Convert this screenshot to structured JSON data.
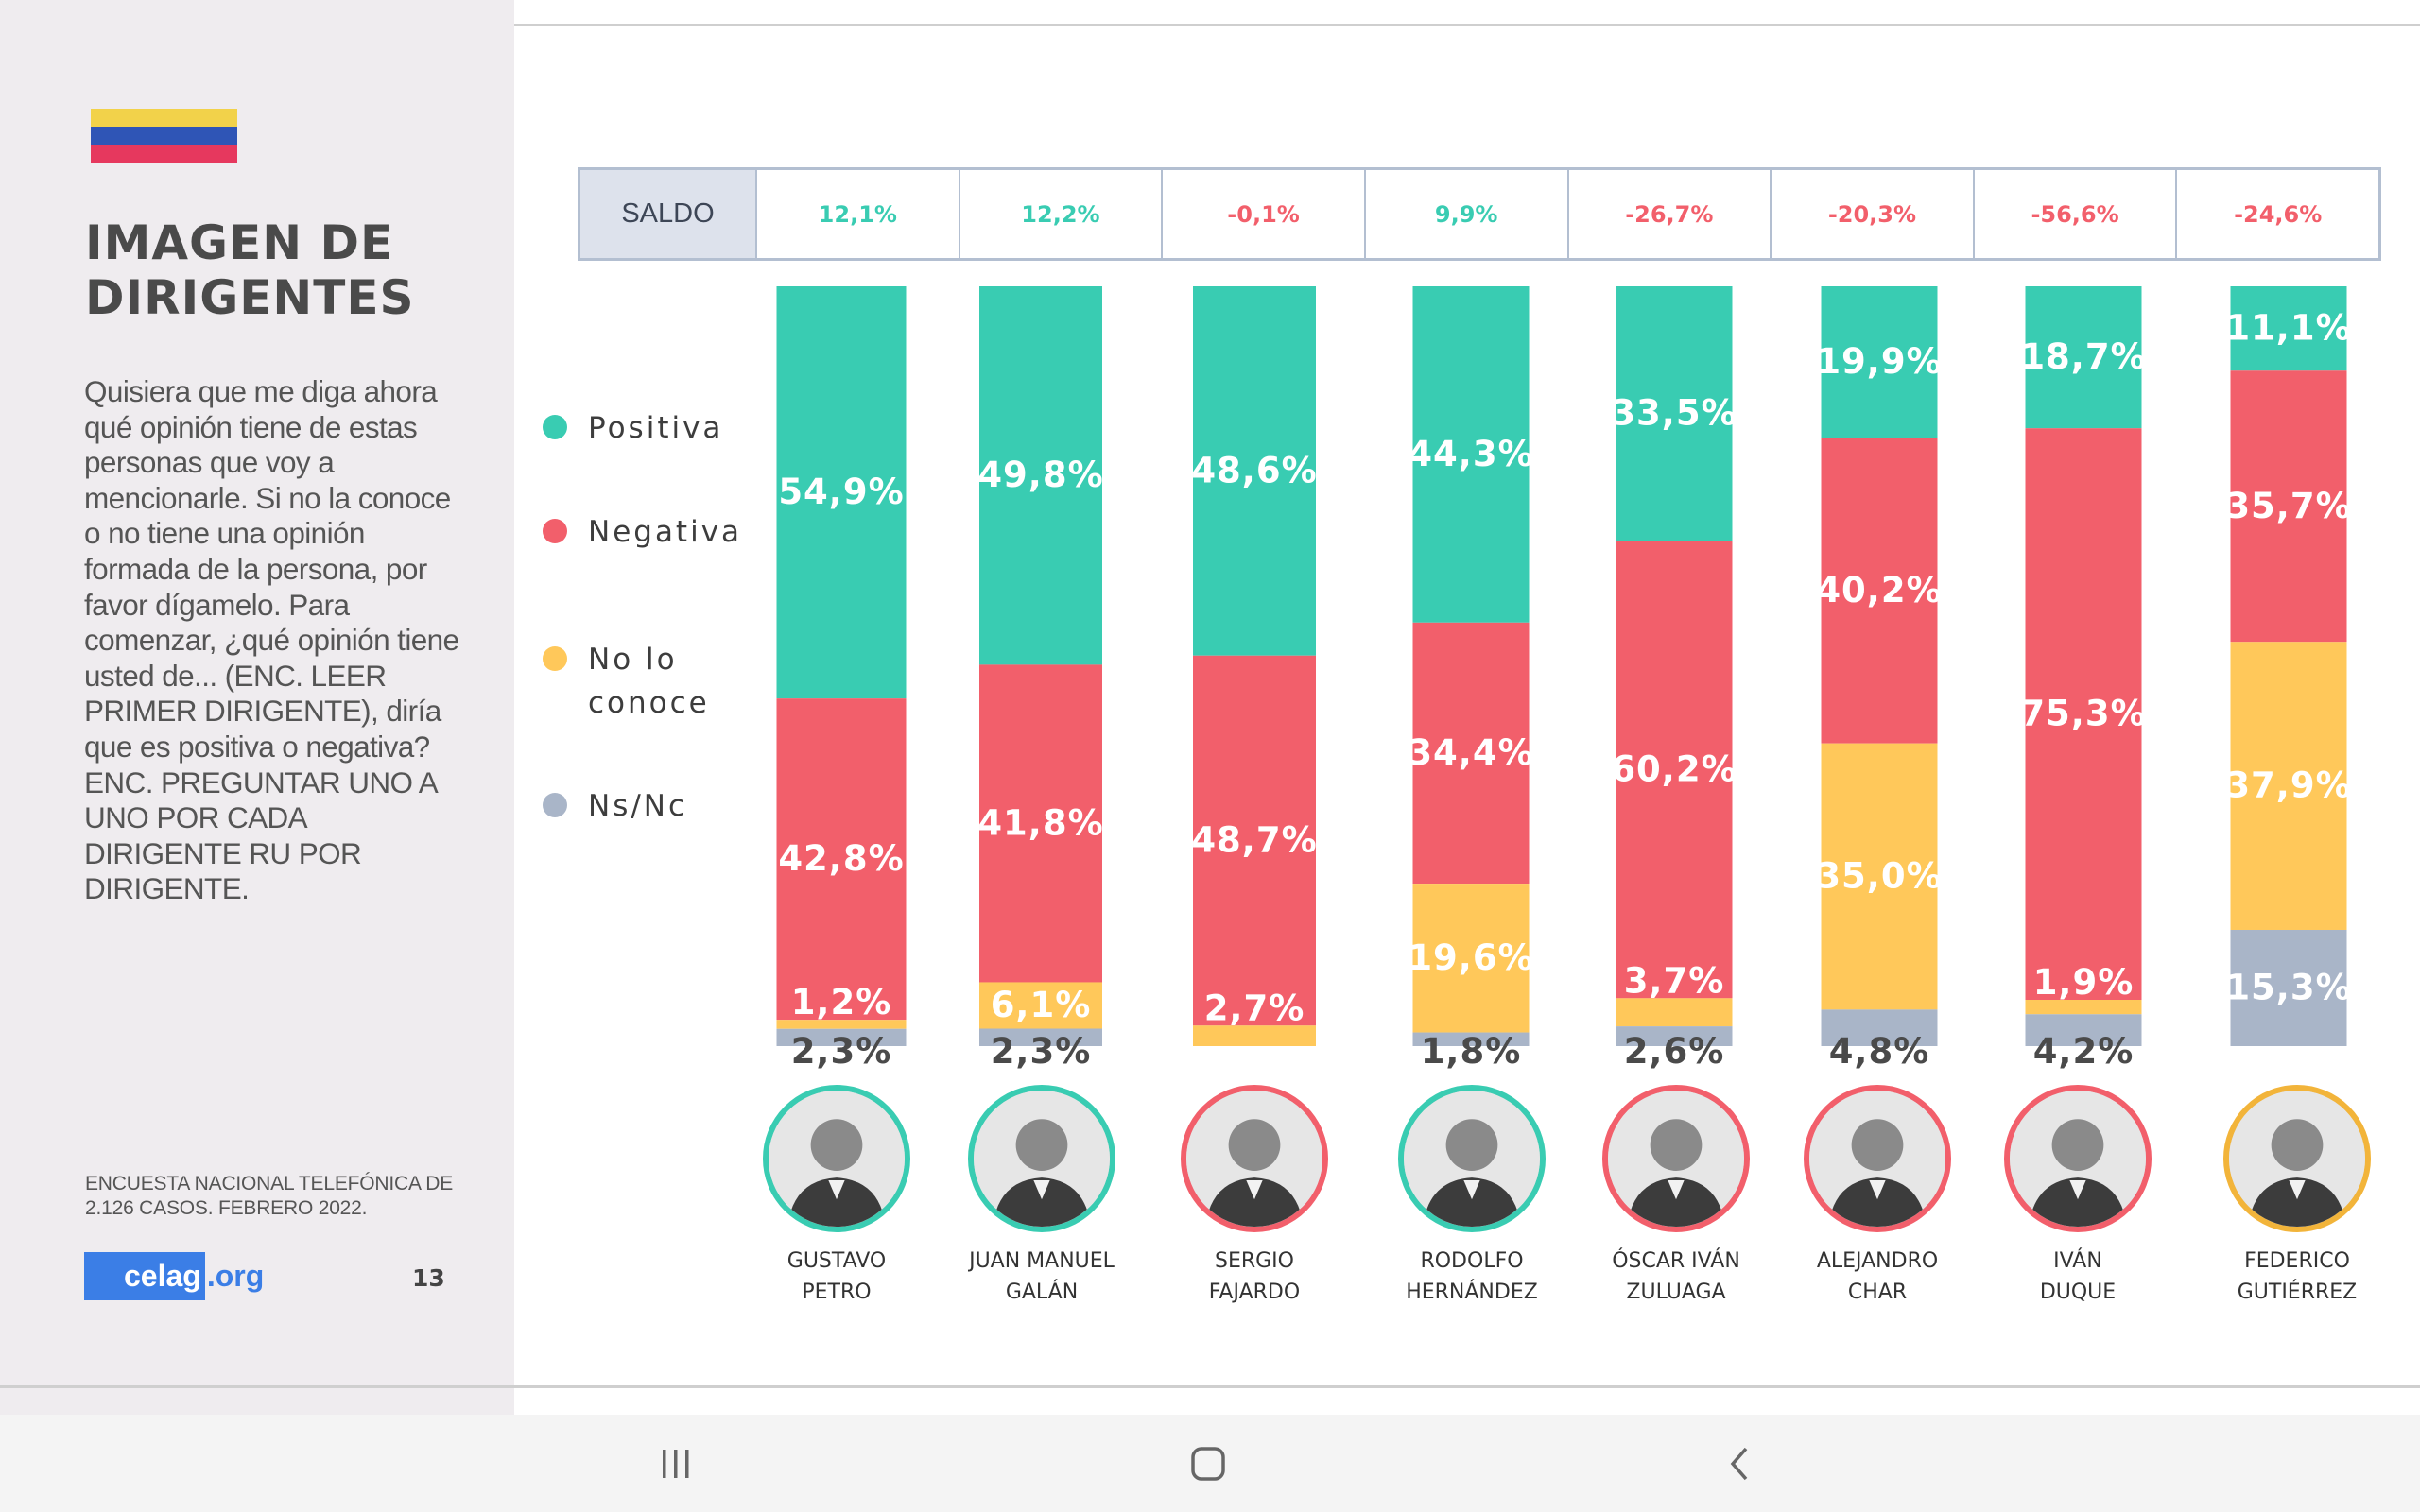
{
  "sidebar": {
    "title": "IMAGEN DE DIRIGENTES",
    "question": "Quisiera que me diga ahora qué opinión tiene de estas personas que voy a mencionarle. Si no la conoce o no tiene una opinión formada de la persona, por favor dígamelo. Para comenzar, ¿qué opinión tiene usted de... (ENC. LEER PRIMER DIRIGENTE), diría que es positiva o negativa? ENC. PREGUNTAR UNO A UNO POR CADA DIRIGENTE RU POR DIRIGENTE.",
    "source": "ENCUESTA NACIONAL TELEFÓNICA DE 2.126 CASOS. FEBRERO 2022.",
    "logo_main": "celag",
    "logo_ext": ".org",
    "page_number": "13"
  },
  "saldo": {
    "label": "SALDO",
    "values": [
      "12,1%",
      "12,2%",
      "-0,1%",
      "9,9%",
      "-26,7%",
      "-20,3%",
      "-56,6%",
      "-24,6%"
    ]
  },
  "legend": [
    {
      "label": "Positiva",
      "color": "#39ccb2"
    },
    {
      "label": "Negativa",
      "color": "#f25f6b"
    },
    {
      "label": "No lo conoce",
      "color": "#ffc85a"
    },
    {
      "label": "Ns/Nc",
      "color": "#a9b5c8"
    }
  ],
  "colors": {
    "positive": "#39ccb2",
    "negative": "#f25f6b",
    "unknown": "#ffc85a",
    "nsnc": "#a9b5c8",
    "saldo_positive": "#39ccb2",
    "saldo_negative": "#f25f6b"
  },
  "chart_data": {
    "type": "bar",
    "stacked": true,
    "categories": [
      "GUSTAVO PETRO",
      "JUAN MANUEL GALÁN",
      "SERGIO FAJARDO",
      "RODOLFO HERNÁNDEZ",
      "ÓSCAR IVÁN ZULUAGA",
      "ALEJANDRO CHAR",
      "IVÁN DUQUE",
      "FEDERICO GUTIÉRREZ"
    ],
    "series": [
      {
        "name": "Positiva",
        "values": [
          54.9,
          49.8,
          48.6,
          44.3,
          33.5,
          19.9,
          18.7,
          11.1
        ],
        "labels": [
          "54,9%",
          "49,8%",
          "48,6%",
          "44,3%",
          "33,5%",
          "19,9%",
          "18,7%",
          "11,1%"
        ]
      },
      {
        "name": "Negativa",
        "values": [
          42.8,
          41.8,
          48.7,
          34.4,
          60.2,
          40.2,
          75.3,
          35.7
        ],
        "labels": [
          "42,8%",
          "41,8%",
          "48,7%",
          "34,4%",
          "60,2%",
          "40,2%",
          "75,3%",
          "35,7%"
        ]
      },
      {
        "name": "No lo conoce",
        "values": [
          1.2,
          6.1,
          2.7,
          19.6,
          3.7,
          35.0,
          1.9,
          37.9
        ],
        "labels": [
          "1,2%",
          "6,1%",
          "2,7%",
          "19,6%",
          "3,7%",
          "35,0%",
          "1,9%",
          "37,9%"
        ]
      },
      {
        "name": "Ns/Nc",
        "values": [
          2.3,
          2.3,
          0,
          1.8,
          2.6,
          4.8,
          4.2,
          15.3
        ],
        "labels": [
          "2,3%",
          "2,3%",
          "",
          "1,8%",
          "2,6%",
          "4,8%",
          "4,2%",
          "15,3%"
        ]
      }
    ],
    "ylim": [
      0,
      100
    ]
  },
  "leaders": [
    {
      "line1": "GUSTAVO",
      "line2": "PETRO",
      "ring": "#39ccb2"
    },
    {
      "line1": "JUAN MANUEL",
      "line2": "GALÁN",
      "ring": "#39ccb2"
    },
    {
      "line1": "SERGIO",
      "line2": "FAJARDO",
      "ring": "#f25f6b"
    },
    {
      "line1": "RODOLFO",
      "line2": "HERNÁNDEZ",
      "ring": "#39ccb2"
    },
    {
      "line1": "ÓSCAR IVÁN",
      "line2": "ZULUAGA",
      "ring": "#f25f6b"
    },
    {
      "line1": "ALEJANDRO",
      "line2": "CHAR",
      "ring": "#f25f6b"
    },
    {
      "line1": "IVÁN",
      "line2": "DUQUE",
      "ring": "#f25f6b"
    },
    {
      "line1": "FEDERICO",
      "line2": "GUTIÉRREZ",
      "ring": "#f2b43a"
    }
  ],
  "navbar": {
    "recent_icon": "recent-apps-icon",
    "home_icon": "home-icon",
    "back_icon": "back-icon"
  }
}
